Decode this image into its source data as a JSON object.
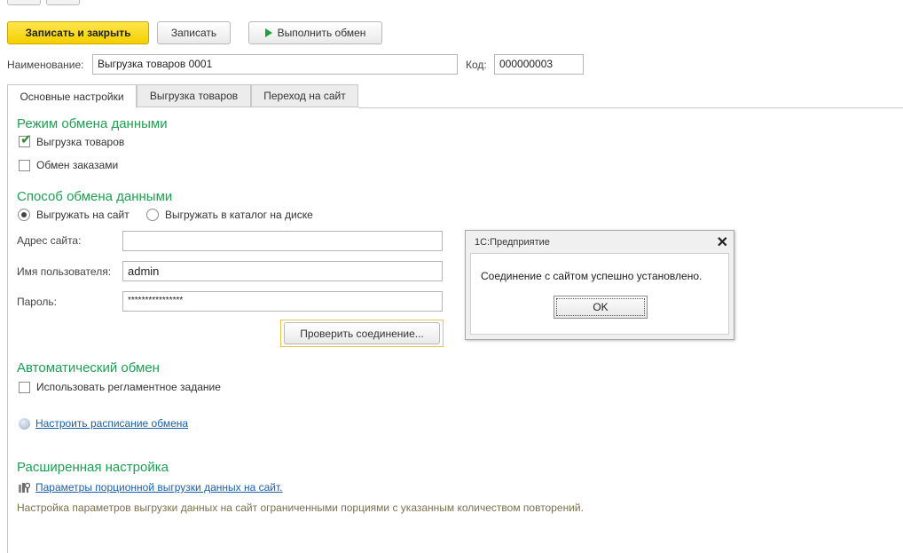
{
  "toolbar": {
    "save_close_label": "Записать и закрыть",
    "save_label": "Записать",
    "run_exchange_label": "Выполнить обмен"
  },
  "header": {
    "name_label": "Наименование:",
    "name_value": "Выгрузка товаров 0001",
    "code_label": "Код:",
    "code_value": "000000003"
  },
  "tabs": [
    {
      "label": "Основные настройки",
      "active": true
    },
    {
      "label": "Выгрузка товаров",
      "active": false
    },
    {
      "label": "Переход на сайт",
      "active": false
    }
  ],
  "mode_section": {
    "title": "Режим обмена данными",
    "export_goods": {
      "label": "Выгрузка товаров",
      "checked": true
    },
    "order_exchange": {
      "label": "Обмен заказами",
      "checked": false
    }
  },
  "method_section": {
    "title": "Способ обмена данными",
    "radio_site": {
      "label": "Выгружать на сайт",
      "selected": true
    },
    "radio_disk": {
      "label": "Выгружать в каталог на диске",
      "selected": false
    },
    "site_address_label": "Адрес сайта:",
    "site_address_value": "",
    "username_label": "Имя пользователя:",
    "username_value": "admin",
    "password_label": "Пароль:",
    "password_value": "****************",
    "check_connection_label": "Проверить соединение..."
  },
  "auto_section": {
    "title": "Автоматический обмен",
    "use_scheduled": {
      "label": "Использовать регламентное задание",
      "checked": false
    },
    "schedule_link": "Настроить расписание обмена"
  },
  "advanced_section": {
    "title": "Расширенная настройка",
    "params_link": "Параметры порционной выгрузки данных на сайт.",
    "description": "Настройка параметров выгрузки данных на сайт ограниченными порциями с указанным количеством повторений."
  },
  "dialog": {
    "title": "1С:Предприятие",
    "message": "Соединение с сайтом успешно установлено.",
    "ok_label": "OK"
  },
  "colors": {
    "accent_green": "#1f9e52",
    "primary_button": "#f4cf00",
    "link_blue": "#1c5fa8"
  }
}
